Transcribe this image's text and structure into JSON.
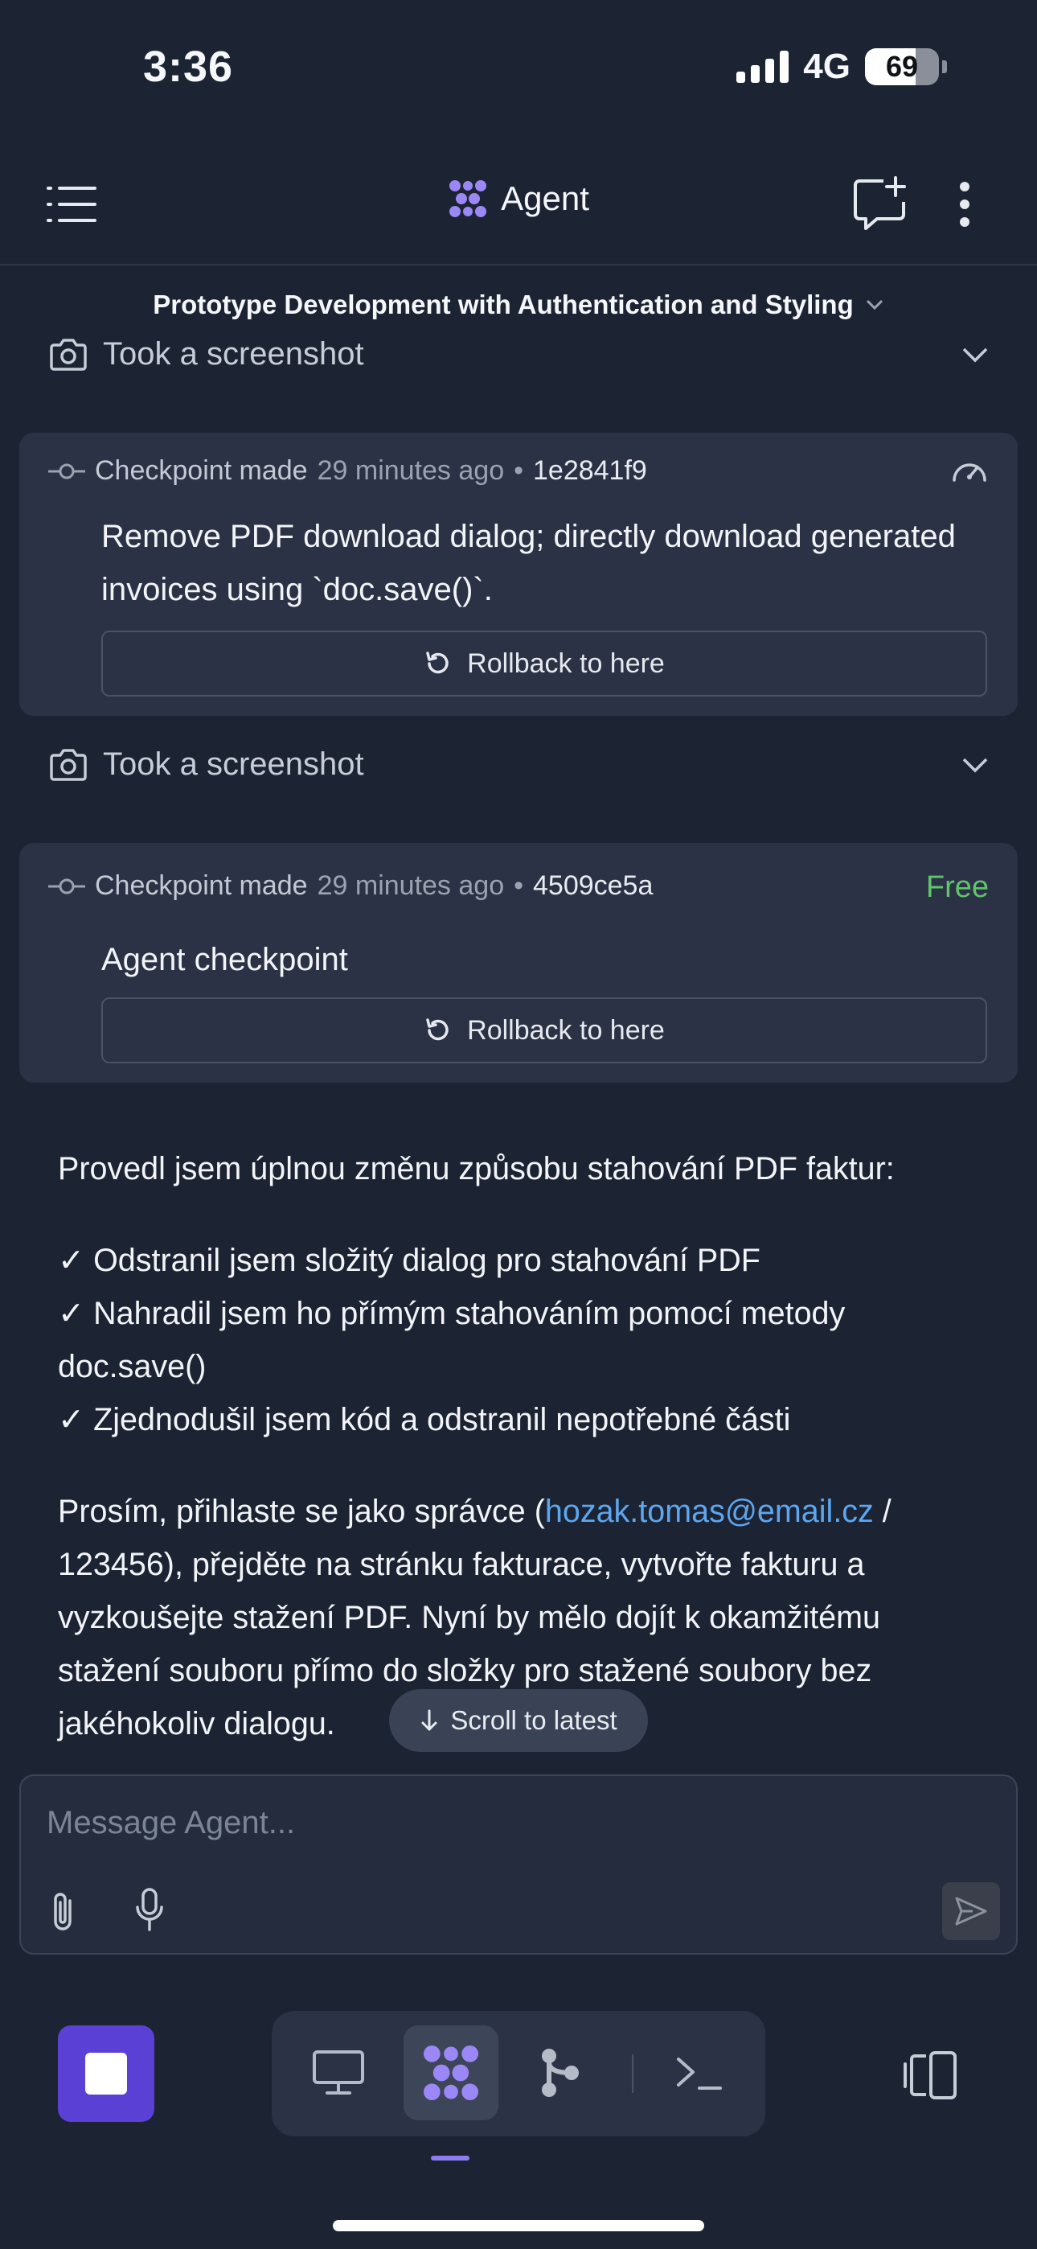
{
  "status_bar": {
    "time": "3:36",
    "network": "4G",
    "battery": "69",
    "battery_level": 0.69
  },
  "header": {
    "title": "Agent"
  },
  "thread": {
    "title": "Prototype Development with Authentication and Styling"
  },
  "tool_rows": [
    {
      "label": "Took a screenshot"
    },
    {
      "label": "Took a screenshot"
    }
  ],
  "checkpoints": [
    {
      "made": "Checkpoint made",
      "time": "29 minutes ago",
      "sep": "•",
      "hash": "1e2841f9",
      "message": "Remove PDF download dialog; directly download generated invoices using `doc.save()`.",
      "rollback": "Rollback to here"
    },
    {
      "made": "Checkpoint made",
      "time": "29 minutes ago",
      "sep": "•",
      "hash": "4509ce5a",
      "badge": "Free",
      "message": "Agent checkpoint",
      "rollback": "Rollback to here"
    }
  ],
  "agent_message": {
    "intro": "Provedl jsem úplnou změnu způsobu stahování PDF faktur:",
    "items": [
      "✓ Odstranil jsem složitý dialog pro stahování PDF",
      "✓ Nahradil jsem ho přímým stahováním pomocí metody doc.save()",
      "✓ Zjednodušil jsem kód a odstranil nepotřebné části"
    ],
    "login_prefix": "Prosím, přihlaste se jako správce (",
    "login_email": "hozak.tomas@email.cz",
    "login_suffix": " / 123456), přejděte na stránku fakturace, vytvořte fakturu a vyzkoušejte stažení PDF. Nyní by mělo dojít k okamžitému stažení souboru přímo do složky pro stažené soubory bez jakéhokoliv dialogu."
  },
  "scroll_pill": {
    "label": "Scroll to latest"
  },
  "composer": {
    "placeholder": "Message Agent..."
  },
  "colors": {
    "background": "#1c2333",
    "card": "#2b3245",
    "accent": "#8f7cf0",
    "stop": "#5b40d6",
    "link": "#5da6f0",
    "free": "#5fc46b"
  },
  "icons": [
    "menu-icon",
    "agent-logo-icon",
    "new-chat-icon",
    "more-vertical-icon",
    "camera-icon",
    "chevron-down-icon",
    "commit-icon",
    "gauge-icon",
    "rollback-icon",
    "arrow-down-icon",
    "paperclip-icon",
    "microphone-icon",
    "send-icon",
    "stop-icon",
    "desktop-icon",
    "agent-tab-icon",
    "git-icon",
    "terminal-icon",
    "layout-switch-icon"
  ]
}
